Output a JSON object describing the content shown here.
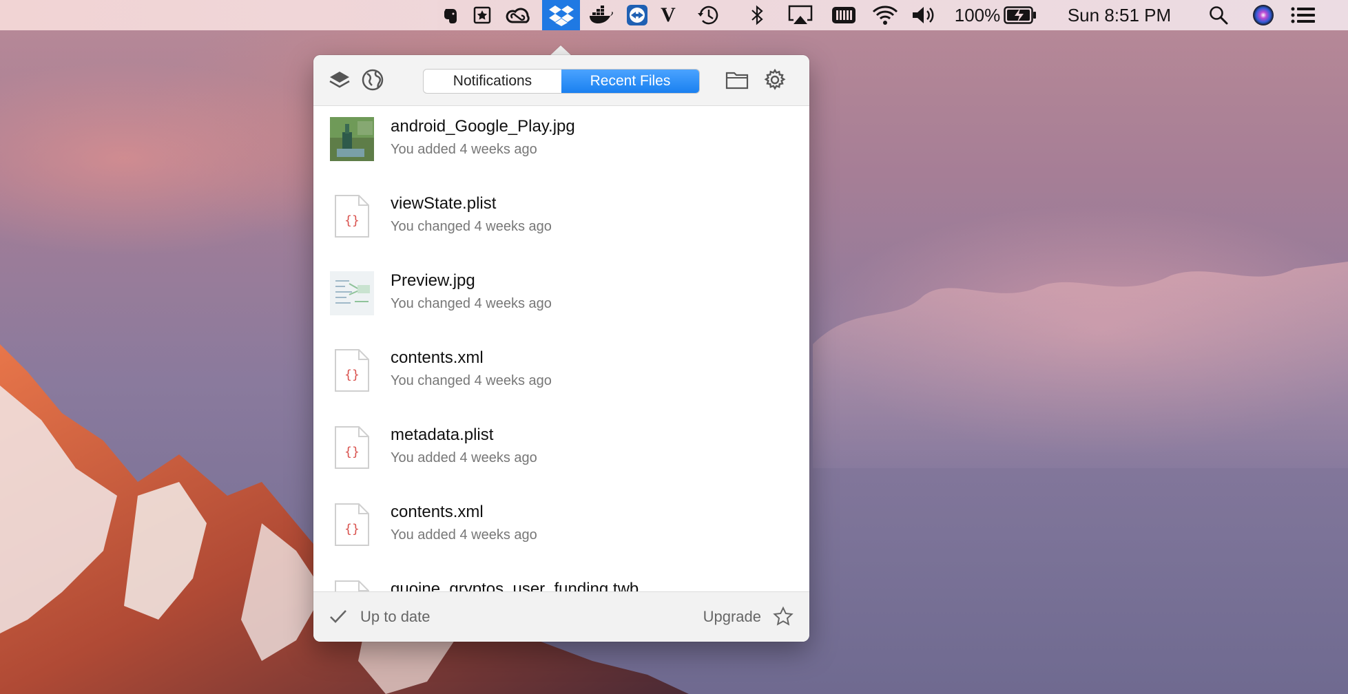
{
  "menubar": {
    "battery_percent": "100%",
    "clock": "Sun 8:51 PM",
    "icons": [
      "evernote-icon",
      "bookmark-icon",
      "creative-cloud-icon",
      "dropbox-icon",
      "docker-icon",
      "teamviewer-icon",
      "vectorize-icon",
      "time-machine-icon",
      "bluetooth-icon",
      "airplay-icon",
      "battery-app-icon",
      "wifi-icon",
      "volume-icon",
      "battery-icon",
      "spotlight-icon",
      "siri-icon",
      "notification-center-icon"
    ]
  },
  "popover": {
    "tabs": {
      "notifications": "Notifications",
      "recent_files": "Recent Files",
      "active": "recent_files"
    },
    "files": [
      {
        "name": "android_Google_Play.jpg",
        "meta": "You added 4 weeks ago",
        "kind": "image-photo"
      },
      {
        "name": "viewState.plist",
        "meta": "You changed 4 weeks ago",
        "kind": "code"
      },
      {
        "name": "Preview.jpg",
        "meta": "You changed 4 weeks ago",
        "kind": "image-diagram"
      },
      {
        "name": "contents.xml",
        "meta": "You changed 4 weeks ago",
        "kind": "code"
      },
      {
        "name": "metadata.plist",
        "meta": "You added 4 weeks ago",
        "kind": "code"
      },
      {
        "name": "contents.xml",
        "meta": "You added 4 weeks ago",
        "kind": "code"
      },
      {
        "name": "guoine_gryptos_user_funding.twb",
        "meta": "",
        "kind": "code"
      }
    ],
    "footer": {
      "status": "Up to date",
      "upgrade": "Upgrade"
    }
  },
  "colors": {
    "accent": "#1a80f0",
    "code_brace": "#d9534f"
  }
}
